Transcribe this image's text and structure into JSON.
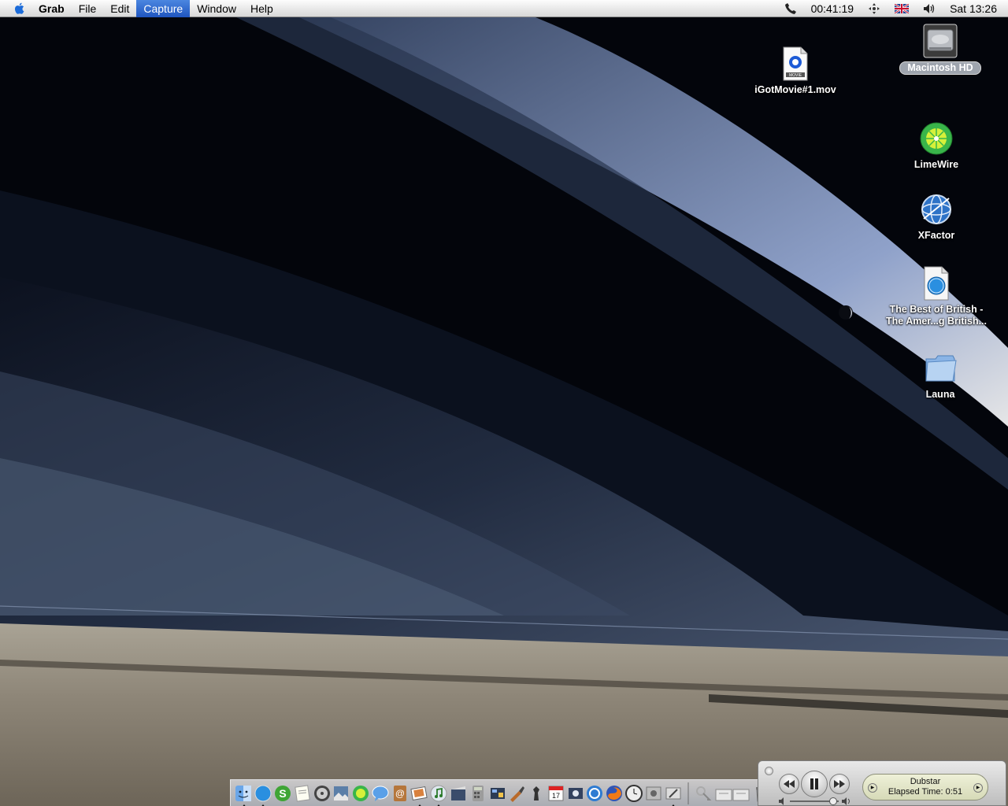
{
  "menubar": {
    "apple_icon": "apple-icon",
    "app_name": "Grab",
    "menus": [
      "File",
      "Edit",
      "Capture",
      "Window",
      "Help"
    ],
    "selected_menu": "Capture",
    "extras": {
      "call_timer": "00:41:19",
      "clock": "Sat 13:26"
    }
  },
  "desktop": {
    "icons": [
      {
        "name": "macintosh-hd",
        "label": "Macintosh HD",
        "icon": "hard-disk-icon",
        "selected": true
      },
      {
        "name": "igotmovie",
        "label": "iGotMovie#1.mov",
        "icon": "quicktime-movie-icon"
      },
      {
        "name": "limewire",
        "label": "LimeWire",
        "icon": "limewire-icon"
      },
      {
        "name": "xfactor",
        "label": "XFactor",
        "icon": "xfactor-globe-icon"
      },
      {
        "name": "best-of-british",
        "label_line1": "The Best of British -",
        "label_line2": "The Amer...g British...",
        "icon": "safari-webloc-icon"
      },
      {
        "name": "launa",
        "label": "Launa",
        "icon": "folder-icon"
      }
    ]
  },
  "dock": {
    "items": [
      "finder-icon",
      "safari-icon",
      "skype-icon",
      "textedit-icon",
      "dvd-player-icon",
      "preview-icon",
      "limewire-icon",
      "ichat-icon",
      "address-book-icon",
      "iphoto-icon",
      "itunes-icon",
      "imovie-icon",
      "calculator-icon",
      "dashboard-icon",
      "garageband-icon",
      "chess-icon",
      "ical-icon",
      "quicktime-icon",
      "mail-icon",
      "firefox-icon",
      "clock-icon",
      "system-prefs-icon",
      "grab-icon",
      "keychain-icon",
      "documents-icon",
      "trash-icon"
    ]
  },
  "miniplayer": {
    "track": "Dubstar",
    "elapsed": "Elapsed Time: 0:51"
  },
  "colors": {
    "menu_selected": "#1f55bf",
    "desktop_bg": "#03050b"
  }
}
